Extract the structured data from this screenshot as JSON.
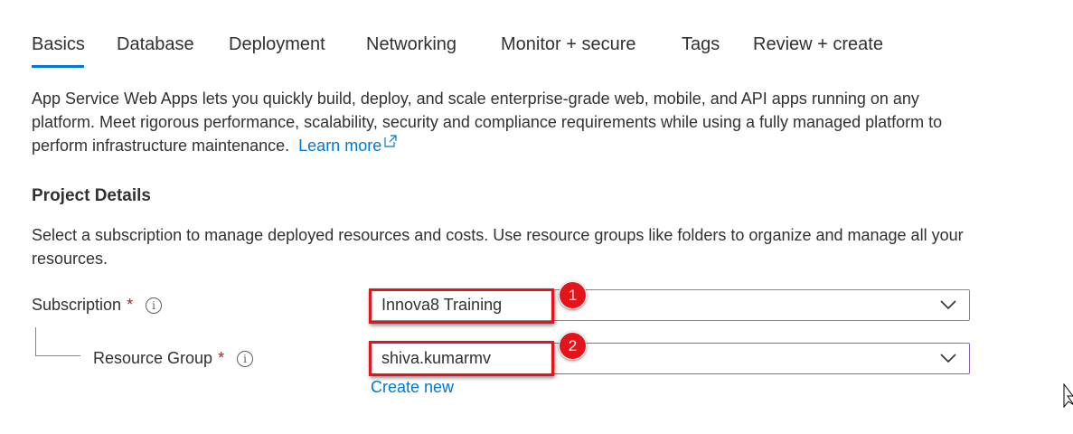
{
  "tabs": [
    {
      "label": "Basics",
      "active": true
    },
    {
      "label": "Database"
    },
    {
      "label": "Deployment"
    },
    {
      "label": "Networking"
    },
    {
      "label": "Monitor + secure"
    },
    {
      "label": "Tags"
    },
    {
      "label": "Review + create"
    }
  ],
  "intro": {
    "text": "App Service Web Apps lets you quickly build, deploy, and scale enterprise-grade web, mobile, and API apps running on any platform. Meet rigorous performance, scalability, security and compliance requirements while using a fully managed platform to perform infrastructure maintenance.",
    "learn_more": "Learn more",
    "learn_more_icon": "external-link-icon"
  },
  "project": {
    "title": "Project Details",
    "description": "Select a subscription to manage deployed resources and costs. Use resource groups like folders to organize and manage all your resources."
  },
  "subscription": {
    "label": "Subscription",
    "required": "*",
    "info": "i",
    "value": "Innova8 Training",
    "badge": "1"
  },
  "resource_group": {
    "label": "Resource Group",
    "required": "*",
    "info": "i",
    "value": "shiva.kumarmv",
    "badge": "2",
    "create_new": "Create new"
  },
  "colors": {
    "accent": "#0078d4",
    "highlight": "#e3141b",
    "required": "#a4262c",
    "focus_border": "#8764b8"
  }
}
